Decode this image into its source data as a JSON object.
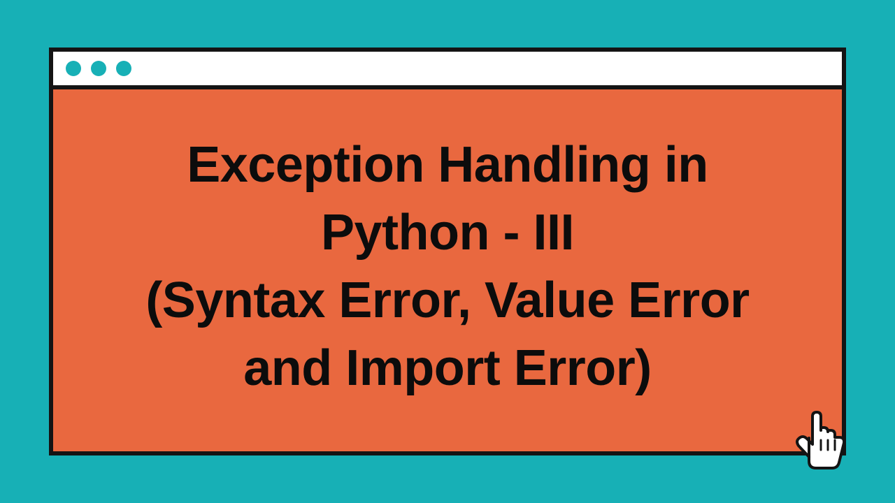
{
  "colors": {
    "background": "#17b0b6",
    "windowBorder": "#141414",
    "titlebar": "#ffffff",
    "titlebarDot": "#17b0b6",
    "panel": "#e9683f",
    "headingText": "#0c0c0c"
  },
  "window": {
    "dotCount": 3
  },
  "content": {
    "title_line1": "Exception Handling in",
    "title_line2": "Python - III",
    "subtitle_line1": "(Syntax Error, Value Error",
    "subtitle_line2": "and Import Error)"
  },
  "cursor": {
    "name": "pointer-cursor-icon"
  }
}
